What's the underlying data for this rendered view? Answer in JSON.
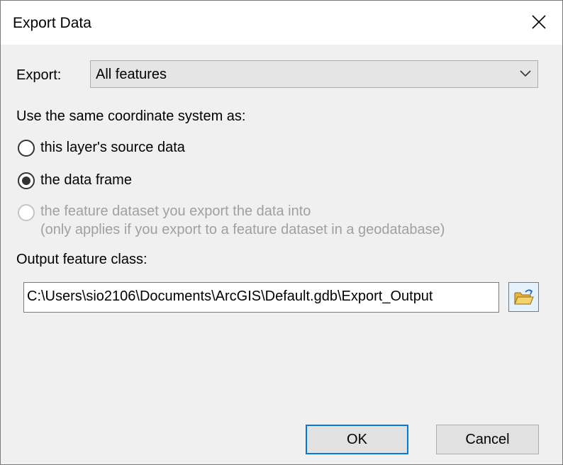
{
  "window": {
    "title": "Export Data",
    "close_glyph": "✕"
  },
  "export": {
    "label": "Export:",
    "selected": "All features"
  },
  "coordinate": {
    "heading": "Use the same coordinate system as:",
    "options": [
      {
        "label": "this layer's source data",
        "checked": false,
        "enabled": true
      },
      {
        "label": "the data frame",
        "checked": true,
        "enabled": true
      },
      {
        "label": "the feature dataset you export the data into",
        "note": "(only applies if you export to a feature dataset in a geodatabase)",
        "checked": false,
        "enabled": false
      }
    ]
  },
  "output": {
    "label": "Output feature class:",
    "path": "C:\\Users\\sio2106\\Documents\\ArcGIS\\Default.gdb\\Export_Output",
    "browse_icon": "open-folder-icon"
  },
  "buttons": {
    "ok": "OK",
    "cancel": "Cancel"
  },
  "colors": {
    "accent": "#0078d7",
    "folder": "#e8b63c",
    "disabled_text": "#a0a0a0"
  }
}
